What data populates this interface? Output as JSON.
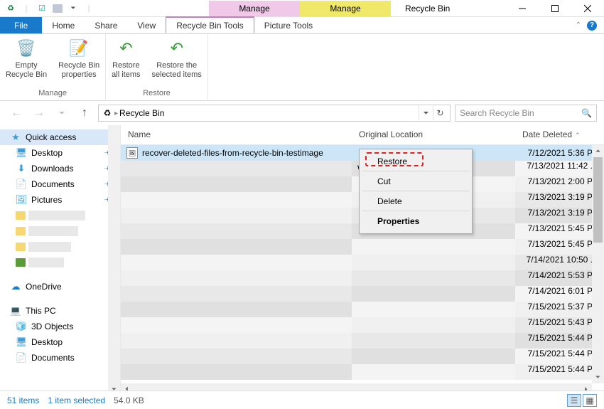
{
  "window": {
    "title": "Recycle Bin",
    "tab_group_pink": "Manage",
    "tab_group_yellow": "Manage"
  },
  "tabs": {
    "file": "File",
    "home": "Home",
    "share": "Share",
    "view": "View",
    "recycle_tools": "Recycle Bin Tools",
    "picture_tools": "Picture Tools"
  },
  "ribbon": {
    "empty": "Empty\nRecycle Bin",
    "props": "Recycle Bin\nproperties",
    "restore_all": "Restore\nall items",
    "restore_sel": "Restore the\nselected items",
    "group_manage": "Manage",
    "group_restore": "Restore"
  },
  "address": {
    "text": "Recycle Bin"
  },
  "search": {
    "placeholder": "Search Recycle Bin"
  },
  "columns": {
    "name": "Name",
    "loc": "Original Location",
    "date": "Date Deleted"
  },
  "sidebar": {
    "quick_access": "Quick access",
    "desktop": "Desktop",
    "downloads": "Downloads",
    "documents": "Documents",
    "pictures": "Pictures",
    "onedrive": "OneDrive",
    "this_pc": "This PC",
    "objects3d": "3D Objects",
    "desktop2": "Desktop",
    "documents2": "Documents"
  },
  "files": [
    {
      "name": "recover-deleted-files-from-recycle-bin-testimage",
      "loc": "",
      "date": "7/12/2021 5:36 P"
    },
    {
      "name": "",
      "loc": "WXWork\\1...",
      "date": "7/13/2021 11:42 ."
    },
    {
      "name": "",
      "loc": "",
      "date": "7/13/2021 2:00 P"
    },
    {
      "name": "",
      "loc": "",
      "date": "7/13/2021 3:19 P"
    },
    {
      "name": "",
      "loc": "",
      "date": "7/13/2021 3:19 P"
    },
    {
      "name": "",
      "loc": "",
      "date": "7/13/2021 5:45 P"
    },
    {
      "name": "",
      "loc": "",
      "date": "7/13/2021 5:45 P"
    },
    {
      "name": "",
      "loc": "",
      "date": "7/14/2021 10:50 ."
    },
    {
      "name": "",
      "loc": "",
      "date": "7/14/2021 5:53 P"
    },
    {
      "name": "",
      "loc": "",
      "date": "7/14/2021 6:01 P"
    },
    {
      "name": "",
      "loc": "",
      "date": "7/15/2021 5:37 P"
    },
    {
      "name": "",
      "loc": "",
      "date": "7/15/2021 5:43 P"
    },
    {
      "name": "",
      "loc": "",
      "date": "7/15/2021 5:44 P"
    },
    {
      "name": "",
      "loc": "",
      "date": "7/15/2021 5:44 P"
    },
    {
      "name": "",
      "loc": "",
      "date": "7/15/2021 5:44 P"
    }
  ],
  "context_menu": {
    "restore": "Restore",
    "cut": "Cut",
    "delete": "Delete",
    "properties": "Properties"
  },
  "status": {
    "count": "51 items",
    "selected": "1 item selected",
    "size": "54.0 KB"
  }
}
